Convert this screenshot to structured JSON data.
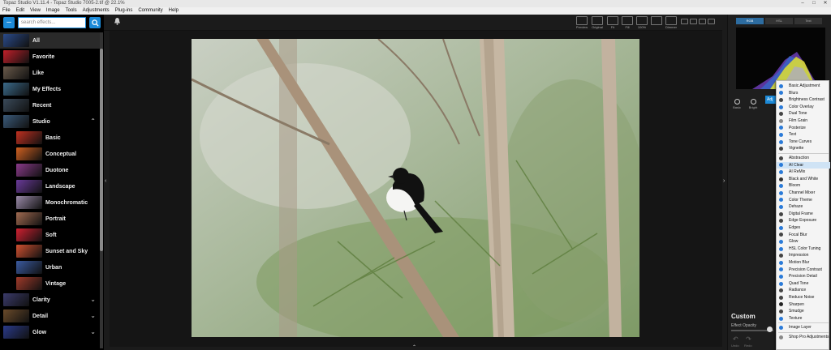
{
  "window": {
    "title": "Topaz Studio V1.11.4 - Topaz Studio 7005-2.tif @ 22.1%",
    "controls": [
      "–",
      "□",
      "✕"
    ]
  },
  "menubar": [
    "File",
    "Edit",
    "View",
    "Image",
    "Tools",
    "Adjustments",
    "Plug-ins",
    "Community",
    "Help"
  ],
  "sidebar": {
    "search_placeholder": "search effects...",
    "categories": [
      {
        "label": "All",
        "color": "#2a4a8a",
        "selected": true
      },
      {
        "label": "Favorite",
        "color": "#c0202a"
      },
      {
        "label": "Like",
        "color": "#6a5a4a"
      },
      {
        "label": "My Effects",
        "color": "#3a6a8a"
      },
      {
        "label": "Recent",
        "color": "#3a4a5a"
      },
      {
        "label": "Studio",
        "color": "#3a5a7a",
        "chevron": "up"
      },
      {
        "label": "Basic",
        "color": "#c03020",
        "sub": true
      },
      {
        "label": "Conceptual",
        "color": "#d06020",
        "sub": true
      },
      {
        "label": "Duotone",
        "color": "#8a3a8a",
        "sub": true
      },
      {
        "label": "Landscape",
        "color": "#6a3a9a",
        "sub": true
      },
      {
        "label": "Monochromatic",
        "color": "#9a8aa8",
        "sub": true
      },
      {
        "label": "Portrait",
        "color": "#a06a50",
        "sub": true
      },
      {
        "label": "Soft",
        "color": "#d02030",
        "sub": true
      },
      {
        "label": "Sunset and Sky",
        "color": "#d05030",
        "sub": true
      },
      {
        "label": "Urban",
        "color": "#3a5aa0",
        "sub": true
      },
      {
        "label": "Vintage",
        "color": "#a03a2a",
        "sub": true
      },
      {
        "label": "Clarity",
        "color": "#3a3a6a",
        "chevron": "down"
      },
      {
        "label": "Detail",
        "color": "#6a4a2a",
        "chevron": "down"
      },
      {
        "label": "Glow",
        "color": "#2a3a8a",
        "chevron": "down"
      }
    ]
  },
  "toolbar": {
    "tools": [
      {
        "label": "Preview"
      },
      {
        "label": "Original"
      },
      {
        "label": "Fit"
      },
      {
        "label": "Fill"
      },
      {
        "label": "100%"
      },
      {
        "label": ""
      },
      {
        "label": "Dimmer"
      }
    ]
  },
  "right_panel": {
    "tabs": [
      "RGB",
      "HSL",
      "Text"
    ],
    "effect_buttons": [
      "Basic",
      "Bright"
    ],
    "adjust_tab": "Adj",
    "custom_label": "Custom",
    "opacity_label": "Effect Opacity",
    "opacity_value": 0.9,
    "undo_labels": [
      "Undo",
      "Redo"
    ]
  },
  "dropdown": {
    "group1": [
      {
        "label": "Basic Adjustment",
        "icon": "#2a7ad8"
      },
      {
        "label": "Blurs",
        "icon": "#2a7ad8"
      },
      {
        "label": "Brightness Contrast",
        "icon": "#444"
      },
      {
        "label": "Color Overlay",
        "icon": "#2a7ad8"
      },
      {
        "label": "Dual Tone",
        "icon": "#444"
      },
      {
        "label": "Film Grain",
        "icon": "#888"
      },
      {
        "label": "Posterize",
        "icon": "#2a7ad8"
      },
      {
        "label": "Text",
        "icon": "#2a7ad8"
      },
      {
        "label": "Tone Curves",
        "icon": "#2a7ad8"
      },
      {
        "label": "Vignette",
        "icon": "#444"
      }
    ],
    "group2": [
      {
        "label": "Abstraction",
        "icon": "#444"
      },
      {
        "label": "AI Clear",
        "icon": "#2a7ad8",
        "highlight": true
      },
      {
        "label": "AI ReMix",
        "icon": "#2a7ad8"
      },
      {
        "label": "Black and White",
        "icon": "#333"
      },
      {
        "label": "Bloom",
        "icon": "#2a7ad8"
      },
      {
        "label": "Channel Mixer",
        "icon": "#2a7ad8"
      },
      {
        "label": "Color Theme",
        "icon": "#2a7ad8"
      },
      {
        "label": "Dehaze",
        "icon": "#2a7ad8"
      },
      {
        "label": "Digital Frame",
        "icon": "#444"
      },
      {
        "label": "Edge Exposure",
        "icon": "#444"
      },
      {
        "label": "Edges",
        "icon": "#2a7ad8"
      },
      {
        "label": "Focal Blur",
        "icon": "#444"
      },
      {
        "label": "Glow",
        "icon": "#2a7ad8"
      },
      {
        "label": "HSL Color Tuning",
        "icon": "#2a7ad8"
      },
      {
        "label": "Impression",
        "icon": "#444"
      },
      {
        "label": "Motion Blur",
        "icon": "#2a7ad8"
      },
      {
        "label": "Precision Contrast",
        "icon": "#2a7ad8"
      },
      {
        "label": "Precision Detail",
        "icon": "#2a7ad8"
      },
      {
        "label": "Quad Tone",
        "icon": "#2a7ad8"
      },
      {
        "label": "Radiance",
        "icon": "#444"
      },
      {
        "label": "Reduce Noise",
        "icon": "#444"
      },
      {
        "label": "Sharpen",
        "icon": "#222"
      },
      {
        "label": "Smudge",
        "icon": "#444"
      },
      {
        "label": "Texture",
        "icon": "#2a7ad8"
      }
    ],
    "group3": [
      {
        "label": "Image Layer",
        "icon": "#2a7ad8"
      }
    ],
    "group4": [
      {
        "label": "Shop Pro Adjustments",
        "icon": "#888"
      }
    ]
  }
}
